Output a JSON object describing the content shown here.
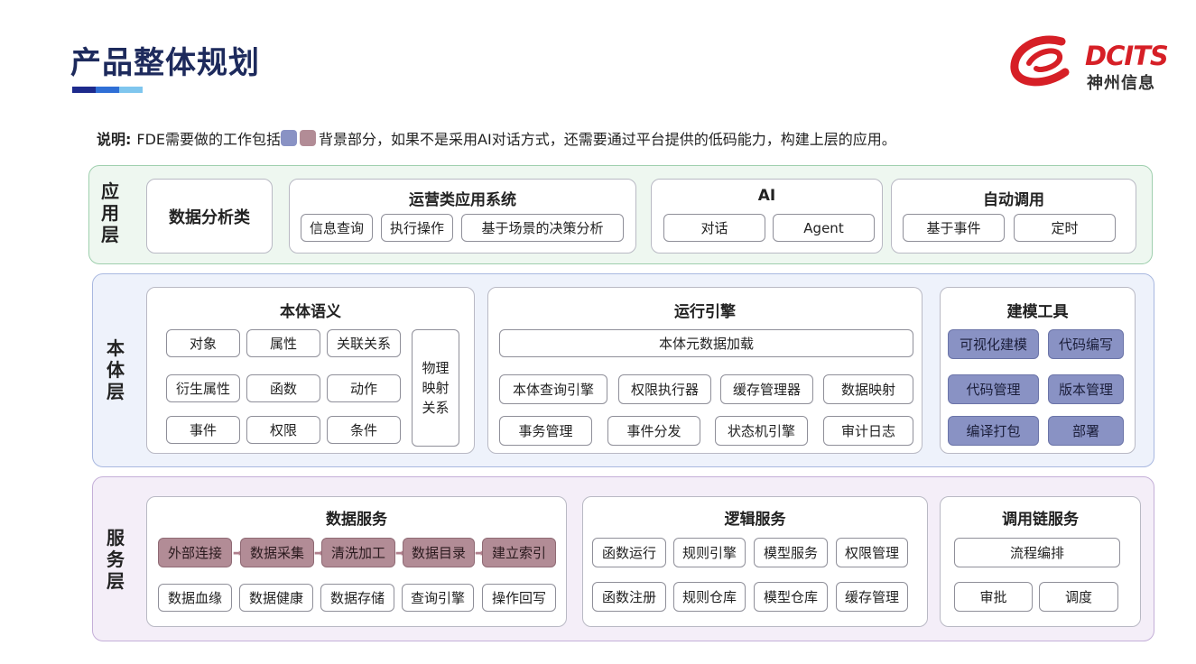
{
  "page": {
    "title": "产品整体规划",
    "logo": {
      "brand": "DCITS",
      "sub": "神州信息"
    },
    "note": {
      "label": "说明:",
      "text_before": "FDE需要做的工作包括",
      "text_after": "背景部分，如果不是采用AI对话方式，还需要通过平台提供的低码能力，构建上层的应用。"
    }
  },
  "colors": {
    "title": "#1d2a5c",
    "app_layer_bg": "#eef7f0",
    "app_layer_border": "#9fcfae",
    "ontology_layer_bg": "#eef2fb",
    "ontology_layer_border": "#a9b8e0",
    "service_layer_bg": "#f4eef8",
    "service_layer_border": "#c4afd8",
    "blue_highlight": "#8992c4",
    "mauve_highlight": "#b28c96",
    "logo_red": "#d61f26"
  },
  "layers": {
    "app": {
      "label": [
        "应",
        "用",
        "层"
      ],
      "data_analysis": "数据分析类",
      "ops": {
        "title": "运营类应用系统",
        "items": [
          "信息查询",
          "执行操作",
          "基于场景的决策分析"
        ]
      },
      "ai": {
        "title": "AI",
        "items": [
          "对话",
          "Agent"
        ]
      },
      "auto": {
        "title": "自动调用",
        "items": [
          "基于事件",
          "定时"
        ]
      }
    },
    "ontology": {
      "label": [
        "本",
        "体",
        "层"
      ],
      "semantic": {
        "title": "本体语义",
        "items": [
          "对象",
          "属性",
          "关联关系",
          "衍生属性",
          "函数",
          "动作",
          "事件",
          "权限",
          "条件"
        ],
        "physical": [
          "物理",
          "映射",
          "关系"
        ]
      },
      "engine": {
        "title": "运行引擎",
        "top": "本体元数据加载",
        "items": [
          "本体查询引擎",
          "权限执行器",
          "缓存管理器",
          "数据映射",
          "事务管理",
          "事件分发",
          "状态机引擎",
          "审计日志"
        ]
      },
      "tools": {
        "title": "建模工具",
        "items": [
          "可视化建模",
          "代码编写",
          "代码管理",
          "版本管理",
          "编译打包",
          "部署"
        ]
      }
    },
    "service": {
      "label": [
        "服",
        "务",
        "层"
      ],
      "data": {
        "title": "数据服务",
        "pipeline": [
          "外部连接",
          "数据采集",
          "清洗加工",
          "数据目录",
          "建立索引"
        ],
        "items": [
          "数据血缘",
          "数据健康",
          "数据存储",
          "查询引擎",
          "操作回写"
        ]
      },
      "logic": {
        "title": "逻辑服务",
        "items": [
          "函数运行",
          "规则引擎",
          "模型服务",
          "权限管理",
          "函数注册",
          "规则仓库",
          "模型仓库",
          "缓存管理"
        ]
      },
      "chain": {
        "title": "调用链服务",
        "top": "流程编排",
        "items": [
          "审批",
          "调度"
        ]
      }
    }
  }
}
